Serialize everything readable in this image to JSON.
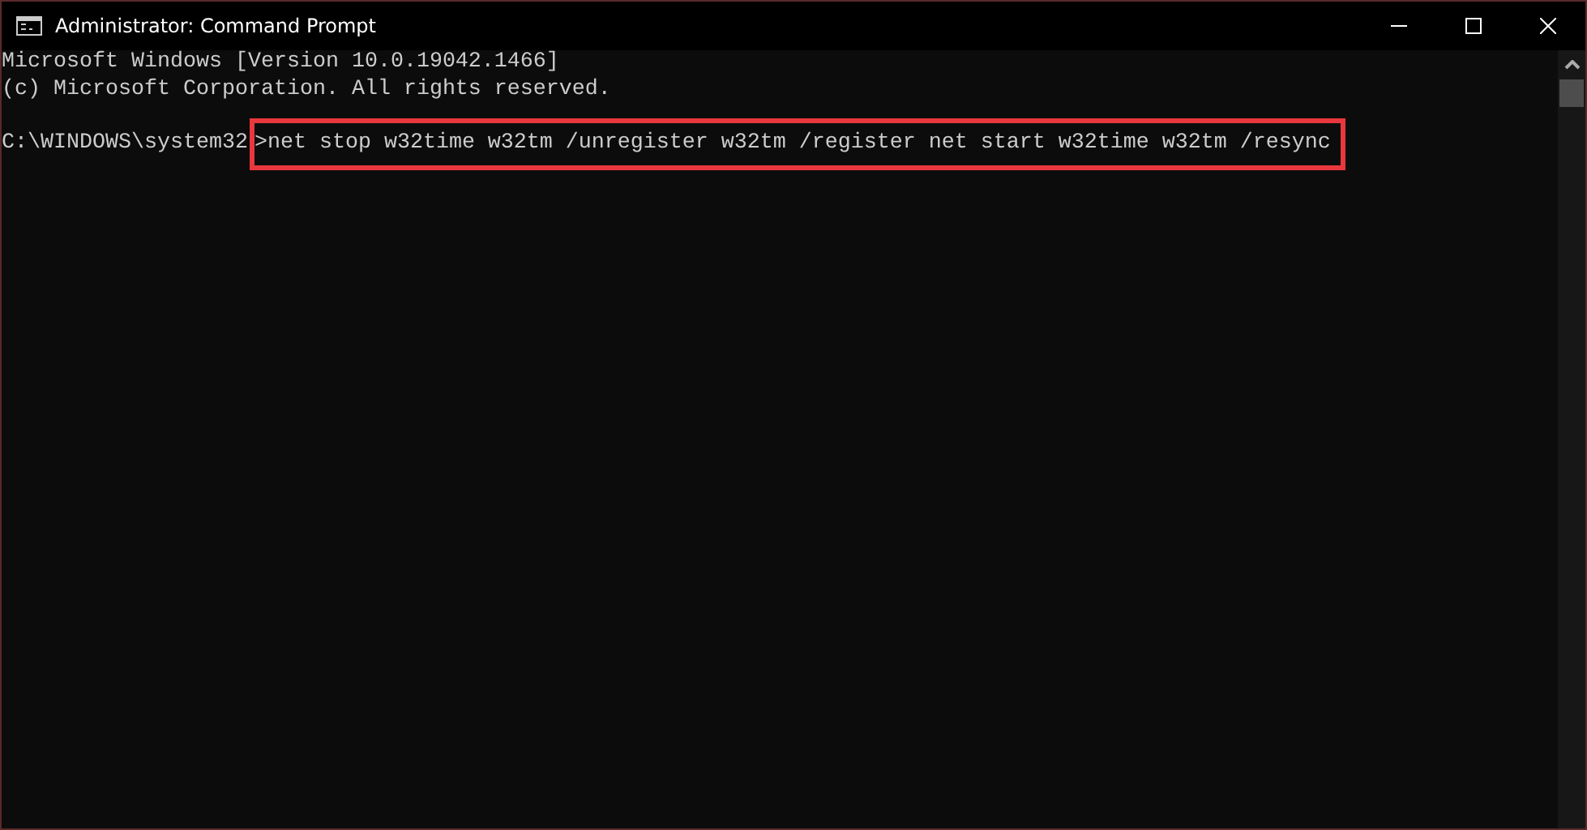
{
  "window": {
    "title": "Administrator: Command Prompt"
  },
  "output_lines": [
    "Microsoft Windows [Version 10.0.19042.1466]",
    "(c) Microsoft Corporation. All rights reserved."
  ],
  "prompt": {
    "path": "C:\\WINDOWS\\system32",
    "command": ">net stop w32time w32tm /unregister w32tm /register net start w32time w32tm /resync",
    "highlighted": true
  }
}
